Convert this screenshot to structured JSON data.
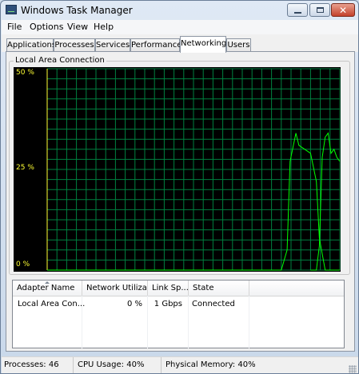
{
  "window": {
    "title": "Windows Task Manager"
  },
  "menu": [
    "File",
    "Options",
    "View",
    "Help"
  ],
  "tabs": [
    {
      "label": "Applications",
      "active": false
    },
    {
      "label": "Processes",
      "active": false
    },
    {
      "label": "Services",
      "active": false
    },
    {
      "label": "Performance",
      "active": false
    },
    {
      "label": "Networking",
      "active": true
    },
    {
      "label": "Users",
      "active": false
    }
  ],
  "network": {
    "group_label": "Local Area Connection",
    "graph": {
      "y_labels": [
        "50 %",
        "25 %",
        "0 %"
      ],
      "ylim": [
        0,
        50
      ],
      "grid_color": "#008040",
      "line_color": "#00ff00",
      "axis_label_color": "#ffff33"
    },
    "table": {
      "headers": [
        "Adapter Name",
        "Network Utiliza...",
        "Link Sp...",
        "State"
      ],
      "rows": [
        {
          "adapter": "Local Area Con...",
          "utilization": "0 %",
          "link_speed": "1 Gbps",
          "state": "Connected"
        }
      ]
    }
  },
  "chart_data": {
    "type": "line",
    "title": "",
    "xlabel": "",
    "ylabel": "",
    "ylim": [
      0,
      50
    ],
    "series": [
      {
        "x": [
          0,
          5,
          10,
          15,
          20,
          25,
          30,
          35,
          40,
          45,
          50,
          55,
          60,
          65,
          70,
          75,
          80,
          82,
          83,
          85,
          86,
          88,
          90,
          92,
          93,
          95,
          96,
          100
        ],
        "values": [
          0,
          0,
          0,
          0,
          0,
          0,
          0,
          0,
          0,
          0,
          0,
          0,
          0,
          0,
          0,
          0,
          0,
          5,
          27,
          34,
          31,
          30,
          29,
          22,
          8,
          0,
          0,
          0
        ]
      },
      {
        "x": [
          90,
          92,
          93,
          94,
          95,
          96,
          97,
          98,
          99,
          100
        ],
        "values": [
          0,
          0,
          6,
          28,
          33,
          34,
          29,
          30,
          28,
          27
        ]
      }
    ]
  },
  "status": {
    "processes": "Processes: 46",
    "cpu": "CPU Usage: 40%",
    "memory": "Physical Memory: 40%"
  }
}
